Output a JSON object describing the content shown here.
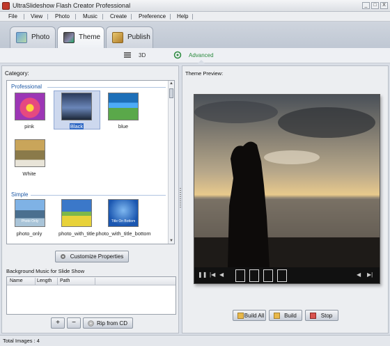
{
  "window": {
    "title": "UltraSlideshow Flash Creator Professional",
    "buttons": [
      "_",
      "□",
      "X"
    ]
  },
  "menu": [
    "File",
    "View",
    "Photo",
    "Music",
    "Create",
    "Preference",
    "Help"
  ],
  "main_tabs": [
    {
      "label": "Photo",
      "active": false,
      "icon": "photo-icon"
    },
    {
      "label": "Theme",
      "active": true,
      "icon": "theme-icon"
    },
    {
      "label": "Publish",
      "active": false,
      "icon": "publish-icon"
    }
  ],
  "sub_tabs": [
    {
      "label": "3D",
      "active": false,
      "icon": "3d-icon"
    },
    {
      "label": "Advanced",
      "active": true,
      "icon": "advanced-icon"
    }
  ],
  "left": {
    "category_label": "Category:",
    "groups": [
      {
        "name": "Professional",
        "items": [
          "pink",
          "Black",
          "blue",
          "White"
        ],
        "selected": "Black"
      },
      {
        "name": "Simple",
        "items": [
          "photo_only",
          "photo_with_title",
          "photo_with_title_bottom"
        ],
        "thumb_captions": [
          "Photo Only",
          "",
          "Title On Bottom"
        ]
      }
    ],
    "customize_button": "Customize Properties",
    "music": {
      "legend": "Background Music for Slide Show",
      "columns": [
        "Name",
        "Length",
        "Path"
      ],
      "add_button": "+",
      "remove_button": "−",
      "rip_button": "Rip from CD"
    }
  },
  "right": {
    "preview_label": "Theme Preview:",
    "build_all_button": "Build All",
    "build_button": "Build",
    "stop_button": "Stop"
  },
  "status": {
    "text": "Total Images : 4"
  }
}
